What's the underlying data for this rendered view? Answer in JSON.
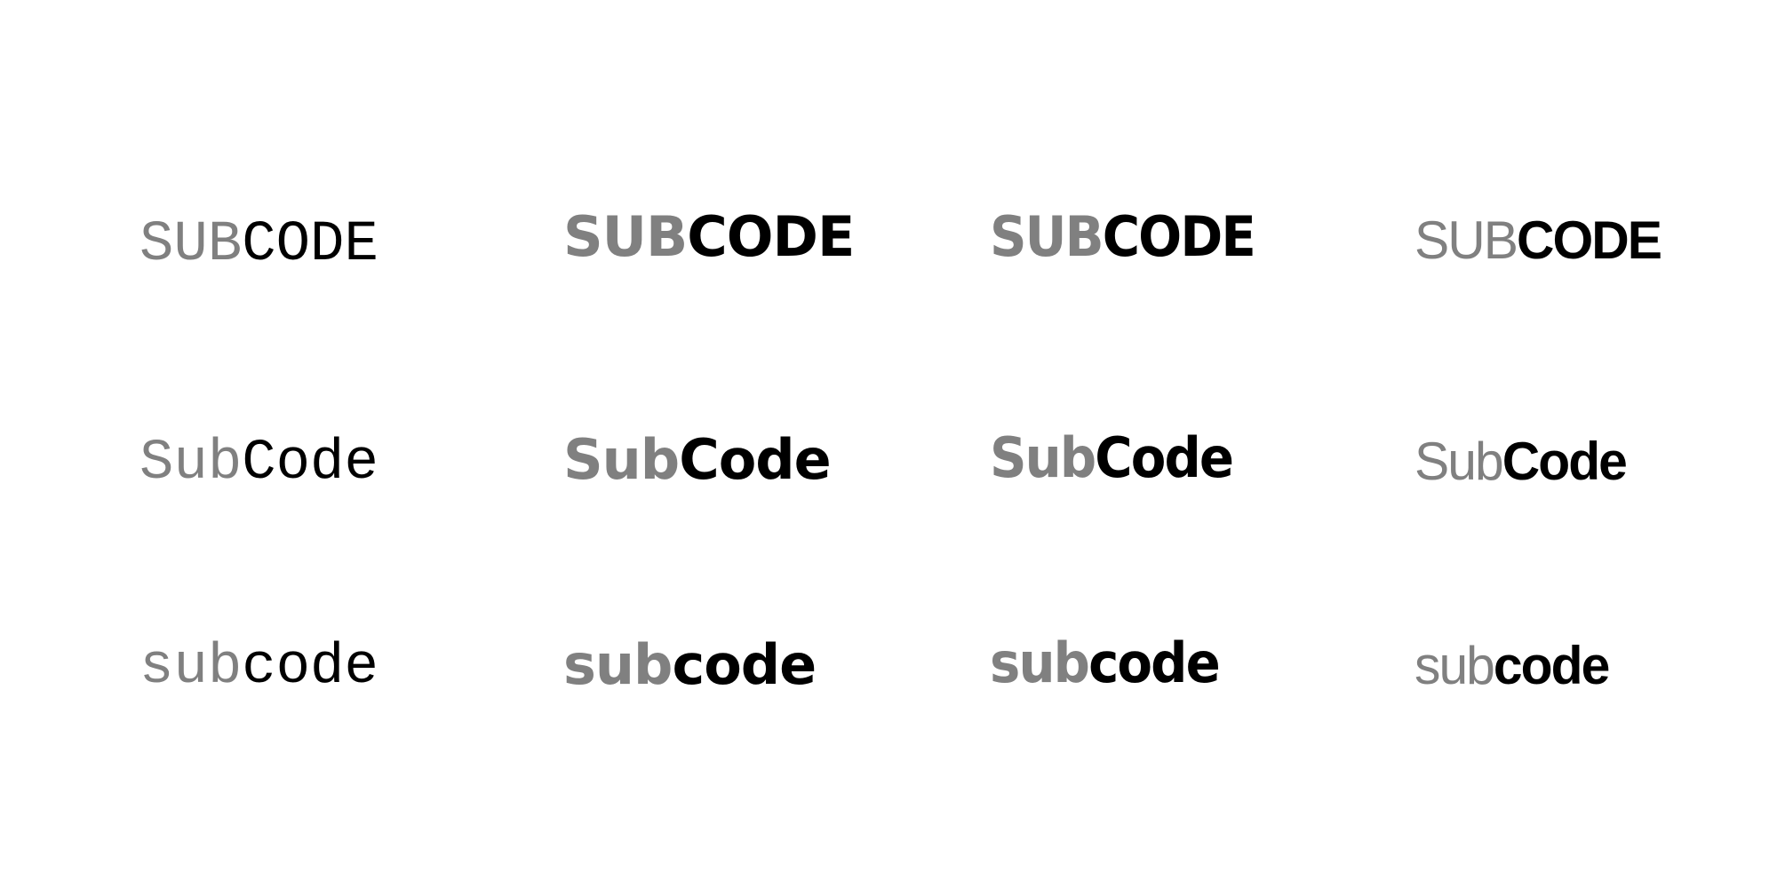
{
  "colors": {
    "sub": "#808080",
    "code": "#000000",
    "background": "#ffffff"
  },
  "rows": [
    {
      "name": "uppercase",
      "items": [
        {
          "sub": "SUB",
          "code": "CODE"
        },
        {
          "sub": "SUB",
          "code": "CODE"
        },
        {
          "sub": "SUB",
          "code": "CODE"
        },
        {
          "sub": "SUB",
          "code": "CODE"
        }
      ]
    },
    {
      "name": "titlecase",
      "items": [
        {
          "sub": "Sub",
          "code": "Code"
        },
        {
          "sub": "Sub",
          "code": "Code"
        },
        {
          "sub": "Sub",
          "code": "Code"
        },
        {
          "sub": "Sub",
          "code": "Code"
        }
      ]
    },
    {
      "name": "lowercase",
      "items": [
        {
          "sub": "sub",
          "code": "code"
        },
        {
          "sub": "sub",
          "code": "code"
        },
        {
          "sub": "sub",
          "code": "code"
        },
        {
          "sub": "sub",
          "code": "code"
        }
      ]
    }
  ]
}
